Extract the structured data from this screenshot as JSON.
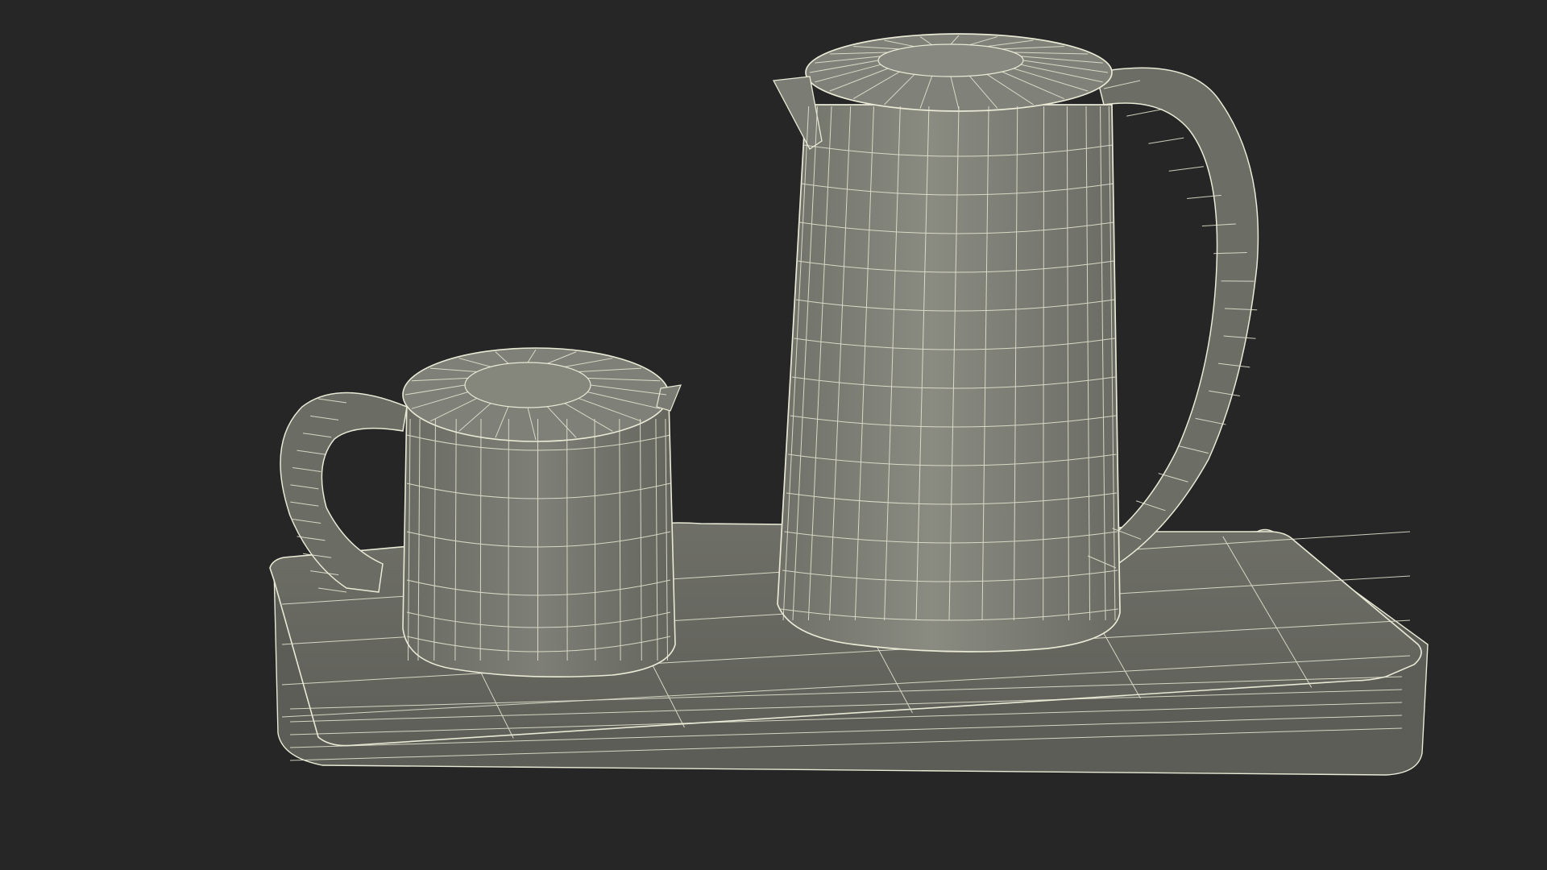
{
  "scene": {
    "background_color": "#262626",
    "mesh_fill_color": "#72736a",
    "mesh_dark_color": "#5d5e56",
    "wire_color": "#e9e9d6",
    "objects": [
      "base-tray",
      "small-teapot",
      "tall-kettle"
    ]
  }
}
